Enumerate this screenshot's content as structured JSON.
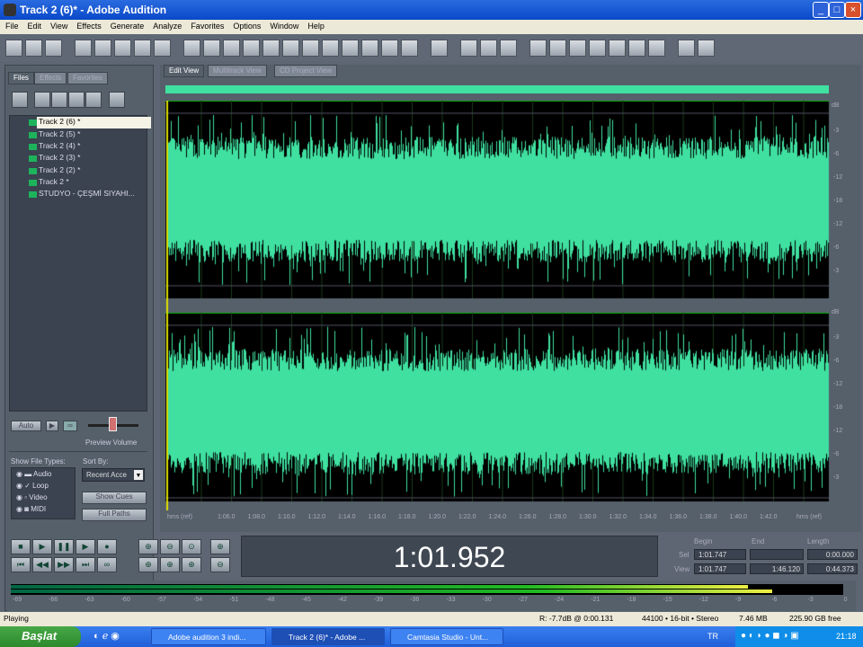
{
  "window": {
    "title": "Track 2 (6)* - Adobe Audition"
  },
  "menu": [
    "File",
    "Edit",
    "View",
    "Effects",
    "Generate",
    "Analyze",
    "Favorites",
    "Options",
    "Window",
    "Help"
  ],
  "left_tabs": [
    "Files",
    "Effects",
    "Favorites"
  ],
  "files": [
    "Track 2 (6) *",
    "Track 2 (5) *",
    "Track 2 (4) *",
    "Track 2 (3) *",
    "Track 2 (2) *",
    "Track 2 *",
    "STUDYO - ÇEŞMİ SIYAHI..."
  ],
  "preview": {
    "auto_label": "Auto",
    "volume_label": "Preview Volume",
    "volume_ticks": [
      "-",
      "o",
      "+"
    ]
  },
  "show_file_types": {
    "label": "Show File Types:",
    "types": [
      "Audio",
      "Loop",
      "Video",
      "MIDI"
    ]
  },
  "sort": {
    "label": "Sort By:",
    "value": "Recent Acce",
    "show_cues": "Show Cues",
    "full_paths": "Full Paths"
  },
  "view_tabs": [
    "Edit View",
    "Multitrack View",
    "CD Project View"
  ],
  "ruler": {
    "unit": "hms (ref)",
    "labels": [
      "1:06.0",
      "1:08.0",
      "1:10.0",
      "1:12.0",
      "1:14.0",
      "1:16.0",
      "1:18.0",
      "1:20.0",
      "1:22.0",
      "1:24.0",
      "1:26.0",
      "1:28.0",
      "1:30.0",
      "1:32.0",
      "1:34.0",
      "1:36.0",
      "1:38.0",
      "1:40.0",
      "1:42.0"
    ]
  },
  "db_scale": {
    "top": "dB",
    "labels": [
      "-3",
      "-6",
      "-12",
      "-18",
      "-12",
      "-6",
      "-3"
    ]
  },
  "time_display": "1:01.952",
  "selection": {
    "headers": [
      "Begin",
      "End",
      "Length"
    ],
    "sel_label": "Sel",
    "view_label": "View",
    "sel": [
      "1:01.747",
      "",
      "0:00.000"
    ],
    "view": [
      "1:01.747",
      "1:46.120",
      "0:44.373"
    ]
  },
  "meter_ticks": [
    "-69",
    "-66",
    "-63",
    "-60",
    "-57",
    "-54",
    "-51",
    "-48",
    "-45",
    "-42",
    "-39",
    "-36",
    "-33",
    "-30",
    "-27",
    "-24",
    "-21",
    "-18",
    "-15",
    "-12",
    "-9",
    "-6",
    "-3",
    "0"
  ],
  "meter_levels_db": [
    -8,
    -6
  ],
  "status": {
    "state": "Playing",
    "peak": "R: -7.7dB @  0:00.131",
    "format": "44100 • 16-bit • Stereo",
    "size": "7.46 MB",
    "free": "225.90 GB free"
  },
  "taskbar": {
    "start": "Başlat",
    "tasks": [
      "Adobe audition 3 indi...",
      "Track 2 (6)* - Adobe ...",
      "Camtasia Studio - Unt..."
    ],
    "lang": "TR",
    "clock": "21:18"
  },
  "colors": {
    "wave": "#3fe0a0",
    "accent": "#1db35b"
  }
}
